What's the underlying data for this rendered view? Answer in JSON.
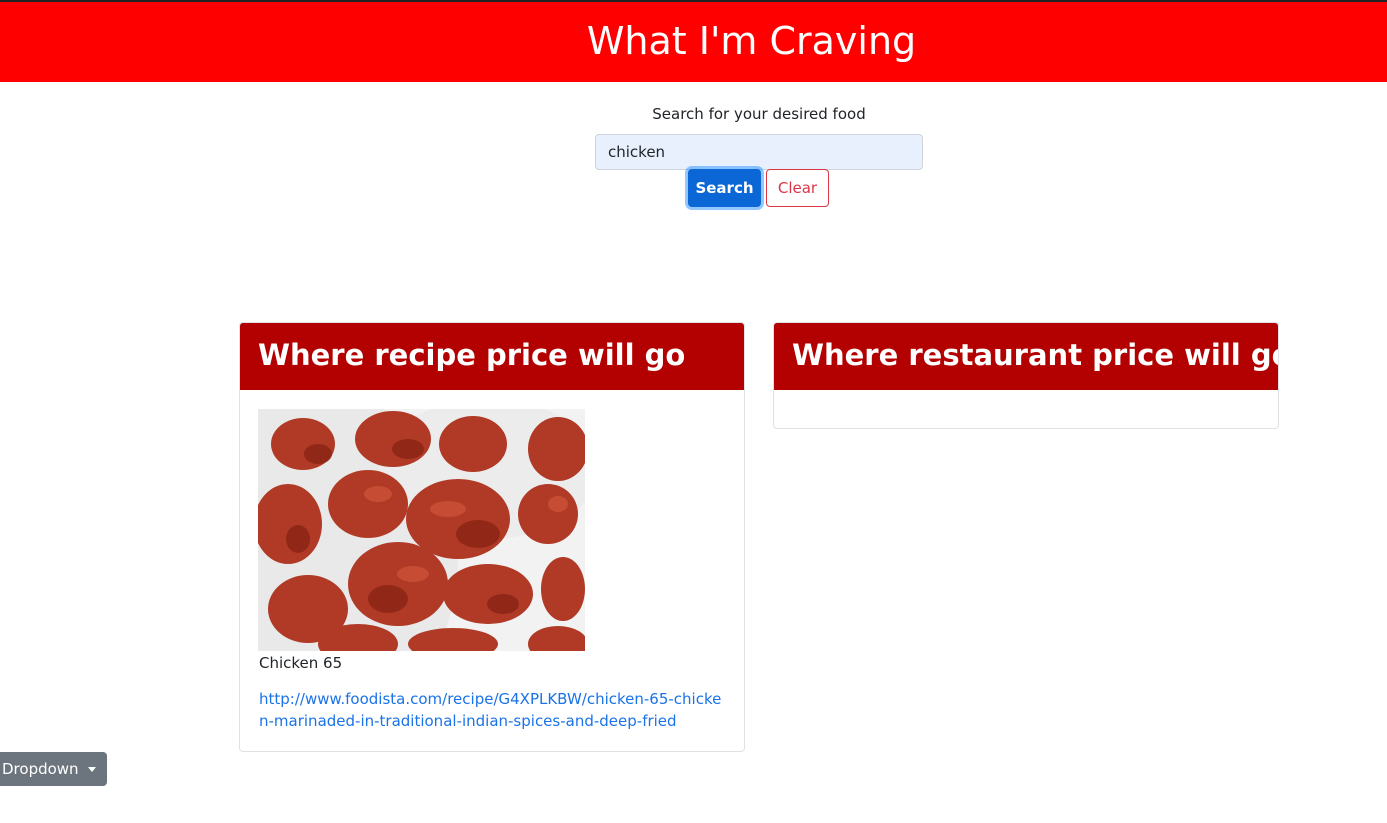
{
  "header": {
    "title": "What I'm Craving",
    "bg_color": "#ff0000"
  },
  "search": {
    "label": "Search for your desired food",
    "value": "chicken",
    "search_button": "Search",
    "clear_button": "Clear"
  },
  "recipe_card": {
    "header": "Where recipe price will go",
    "item_title": "Chicken 65",
    "item_link": "http://www.foodista.com/recipe/G4XPLKBW/chicken-65-chicken-marinaded-in-traditional-indian-spices-and-deep-fried",
    "image_icon": "fried-chicken-photo"
  },
  "restaurant_card": {
    "header": "Where restaurant price will go"
  },
  "dropdown": {
    "label": "Dropdown",
    "icon": "caret-down-icon"
  },
  "colors": {
    "accent": "#ff0000",
    "card_header": "#b30000",
    "primary_button": "#0b66d6",
    "danger": "#dc3545",
    "link": "#1a73e8",
    "dropdown": "#6c757d"
  }
}
